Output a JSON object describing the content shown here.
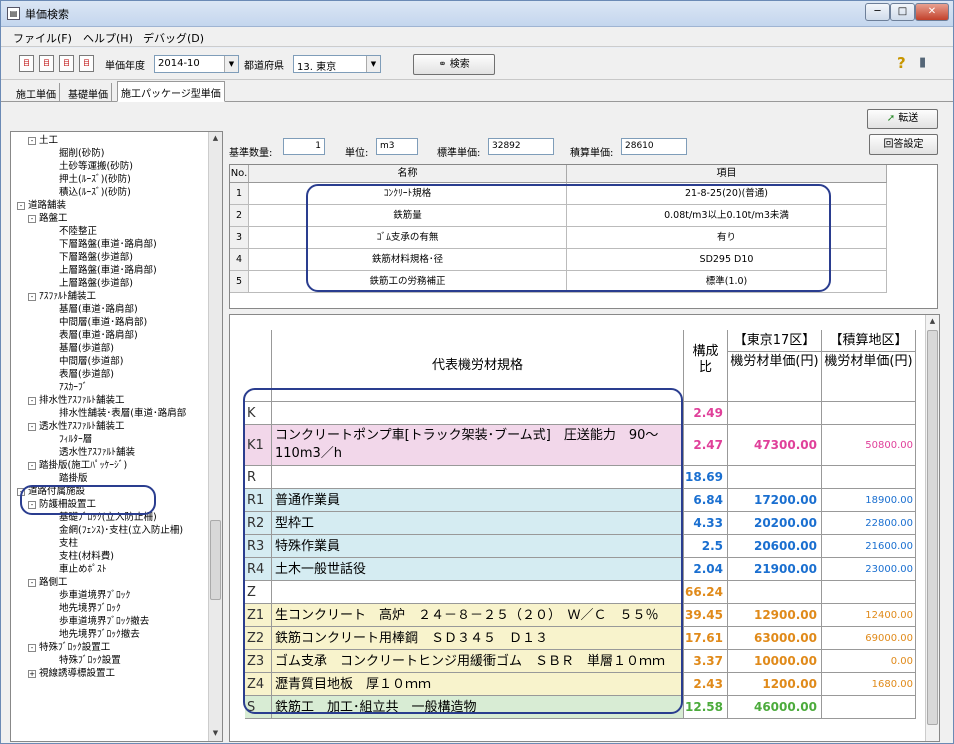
{
  "window": {
    "title": "単価検索",
    "btn_min": "─",
    "btn_max": "□",
    "btn_close": "✕"
  },
  "menu": [
    "ファイル(F)",
    "ヘルプ(H)",
    "デバッグ(D)"
  ],
  "toolbar": {
    "icons": [
      "tb-icon-1",
      "tb-icon-2",
      "tb-icon-3",
      "tb-icon-4"
    ],
    "year_label": "単価年度",
    "year_value": "2014-10",
    "pref_label": "都道府県",
    "pref_value": "13. 東京",
    "search_label": "検索",
    "search_icon": "binoculars-icon",
    "help_icon": "?",
    "info_icon": "▮"
  },
  "tabs": [
    "施工単価",
    "基礎単価",
    "施工パッケージ型単価"
  ],
  "convert_label": "転送",
  "params": {
    "qty_label": "基準数量:",
    "qty_value": "1",
    "unit_label": "単位:",
    "unit_value": "m3",
    "std_label": "標準単価:",
    "std_value": "32892",
    "est_label": "積算単価:",
    "est_value": "28610",
    "answer_btn": "回答設定"
  },
  "grid1": {
    "headers": [
      "No.",
      "名称",
      "項目"
    ],
    "rows": [
      {
        "no": "1",
        "name": "ｺﾝｸﾘｰﾄ規格",
        "item": "21-8-25(20)(普通)"
      },
      {
        "no": "2",
        "name": "鉄筋量",
        "item": "0.08t/m3以上0.10t/m3未満"
      },
      {
        "no": "3",
        "name": "ｺﾞﾑ支承の有無",
        "item": "有り"
      },
      {
        "no": "4",
        "name": "鉄筋材料規格･径",
        "item": "SD295 D10"
      },
      {
        "no": "5",
        "name": "鉄筋工の労務補正",
        "item": "標準(1.0)"
      }
    ]
  },
  "grid2": {
    "h_spec": "代表機労材規格",
    "h_ratio": "構成比",
    "h_tokyo_region": "【東京17区】",
    "h_tokyo_price": "機労材単価(円)",
    "h_est_region": "【積算地区】",
    "h_est_price": "機労材単価(円)",
    "rows": [
      {
        "code": "K",
        "name": "",
        "ratio": "2.49",
        "tokyo": "",
        "est": "",
        "bg": "#ffffff",
        "rc": "#e0409a"
      },
      {
        "code": "K1",
        "name": "コンクリートポンプ車[トラック架装･ブーム式]　圧送能力　90～110m3／h",
        "ratio": "2.47",
        "tokyo": "47300.00",
        "est": "50800.00",
        "bg": "#f2d7ea",
        "rc": "#e0409a"
      },
      {
        "code": "R",
        "name": "",
        "ratio": "18.69",
        "tokyo": "",
        "est": "",
        "bg": "#ffffff",
        "rc": "#1a6fd0"
      },
      {
        "code": "R1",
        "name": "普通作業員",
        "ratio": "6.84",
        "tokyo": "17200.00",
        "est": "18900.00",
        "bg": "#d5ecf2",
        "rc": "#1a6fd0"
      },
      {
        "code": "R2",
        "name": "型枠工",
        "ratio": "4.33",
        "tokyo": "20200.00",
        "est": "22800.00",
        "bg": "#d5ecf2",
        "rc": "#1a6fd0"
      },
      {
        "code": "R3",
        "name": "特殊作業員",
        "ratio": "2.5",
        "tokyo": "20600.00",
        "est": "21600.00",
        "bg": "#d5ecf2",
        "rc": "#1a6fd0"
      },
      {
        "code": "R4",
        "name": "土木一般世話役",
        "ratio": "2.04",
        "tokyo": "21900.00",
        "est": "23000.00",
        "bg": "#d5ecf2",
        "rc": "#1a6fd0"
      },
      {
        "code": "Z",
        "name": "",
        "ratio": "66.24",
        "tokyo": "",
        "est": "",
        "bg": "#ffffff",
        "rc": "#e08a1a"
      },
      {
        "code": "Z1",
        "name": "生コンクリート　高炉　２４－８－２５（２０）　Ｗ／Ｃ　５５％",
        "ratio": "39.45",
        "tokyo": "12900.00",
        "est": "12400.00",
        "bg": "#f8f3cc",
        "rc": "#e08a1a"
      },
      {
        "code": "Z2",
        "name": "鉄筋コンクリート用棒鋼　ＳＤ３４５　Ｄ１３",
        "ratio": "17.61",
        "tokyo": "63000.00",
        "est": "69000.00",
        "bg": "#f8f3cc",
        "rc": "#e08a1a"
      },
      {
        "code": "Z3",
        "name": "ゴム支承　コンクリートヒンジ用緩衝ゴム　ＳＢＲ　単層１０ｍｍ",
        "ratio": "3.37",
        "tokyo": "10000.00",
        "est": "0.00",
        "bg": "#f8f3cc",
        "rc": "#e08a1a"
      },
      {
        "code": "Z4",
        "name": "瀝青質目地板　厚１０ｍｍ",
        "ratio": "2.43",
        "tokyo": "1200.00",
        "est": "1680.00",
        "bg": "#f8f3cc",
        "rc": "#e08a1a"
      },
      {
        "code": "S",
        "name": "鉄筋工　加工･組立共　一般構造物",
        "ratio": "12.58",
        "tokyo": "46000.00",
        "est": "",
        "bg": "#d8ecd4",
        "rc": "#4cab3c"
      }
    ]
  },
  "tree": [
    {
      "t": "土工",
      "lv": 1,
      "box": "-"
    },
    {
      "t": "掘削(砂防)",
      "lv": 3
    },
    {
      "t": "土砂等運搬(砂防)",
      "lv": 3
    },
    {
      "t": "押土(ﾙｰｽﾞ)(砂防)",
      "lv": 3
    },
    {
      "t": "積込(ﾙｰｽﾞ)(砂防)",
      "lv": 3
    },
    {
      "t": "道路舗装",
      "lv": 0,
      "box": "-"
    },
    {
      "t": "路盤工",
      "lv": 1,
      "box": "-"
    },
    {
      "t": "不陸整正",
      "lv": 3
    },
    {
      "t": "下層路盤(車道･路肩部)",
      "lv": 3
    },
    {
      "t": "下層路盤(歩道部)",
      "lv": 3
    },
    {
      "t": "上層路盤(車道･路肩部)",
      "lv": 3
    },
    {
      "t": "上層路盤(歩道部)",
      "lv": 3
    },
    {
      "t": "ｱｽﾌｧﾙﾄ舗装工",
      "lv": 1,
      "box": "-"
    },
    {
      "t": "基層(車道･路肩部)",
      "lv": 3
    },
    {
      "t": "中間層(車道･路肩部)",
      "lv": 3
    },
    {
      "t": "表層(車道･路肩部)",
      "lv": 3
    },
    {
      "t": "基層(歩道部)",
      "lv": 3
    },
    {
      "t": "中間層(歩道部)",
      "lv": 3
    },
    {
      "t": "表層(歩道部)",
      "lv": 3
    },
    {
      "t": "ｱｽｶｰﾌﾞ",
      "lv": 3
    },
    {
      "t": "排水性ｱｽﾌｧﾙﾄ舗装工",
      "lv": 1,
      "box": "-"
    },
    {
      "t": "排水性舗装･表層(車道･路肩部",
      "lv": 3
    },
    {
      "t": "透水性ｱｽﾌｧﾙﾄ舗装工",
      "lv": 1,
      "box": "-"
    },
    {
      "t": "ﾌｨﾙﾀｰ層",
      "lv": 3
    },
    {
      "t": "透水性ｱｽﾌｧﾙﾄ舗装",
      "lv": 3
    },
    {
      "t": "踏掛版(施工ﾊﾟｯｹｰｼﾞ)",
      "lv": 1,
      "box": "-"
    },
    {
      "t": "踏掛版",
      "lv": 3
    },
    {
      "t": "道路付属施設",
      "lv": 0,
      "box": "-"
    },
    {
      "t": "防護柵設置工",
      "lv": 1,
      "box": "-"
    },
    {
      "t": "基礎ﾌﾞﾛｯｸ(立入防止柵)",
      "lv": 3
    },
    {
      "t": "金網(ﾌｪﾝｽ)･支柱(立入防止柵)",
      "lv": 3
    },
    {
      "t": "支柱",
      "lv": 3
    },
    {
      "t": "支柱(材料費)",
      "lv": 3
    },
    {
      "t": "車止めﾎﾟｽﾄ",
      "lv": 3
    },
    {
      "t": "路側工",
      "lv": 1,
      "box": "-"
    },
    {
      "t": "歩車道境界ﾌﾞﾛｯｸ",
      "lv": 3
    },
    {
      "t": "地先境界ﾌﾞﾛｯｸ",
      "lv": 3
    },
    {
      "t": "歩車道境界ﾌﾞﾛｯｸ撤去",
      "lv": 3
    },
    {
      "t": "地先境界ﾌﾞﾛｯｸ撤去",
      "lv": 3
    },
    {
      "t": "特殊ﾌﾞﾛｯｸ設置工",
      "lv": 1,
      "box": "-"
    },
    {
      "t": "特殊ﾌﾞﾛｯｸ設置",
      "lv": 3
    },
    {
      "t": "視線誘導標設置工",
      "lv": 1,
      "box": "+"
    }
  ]
}
